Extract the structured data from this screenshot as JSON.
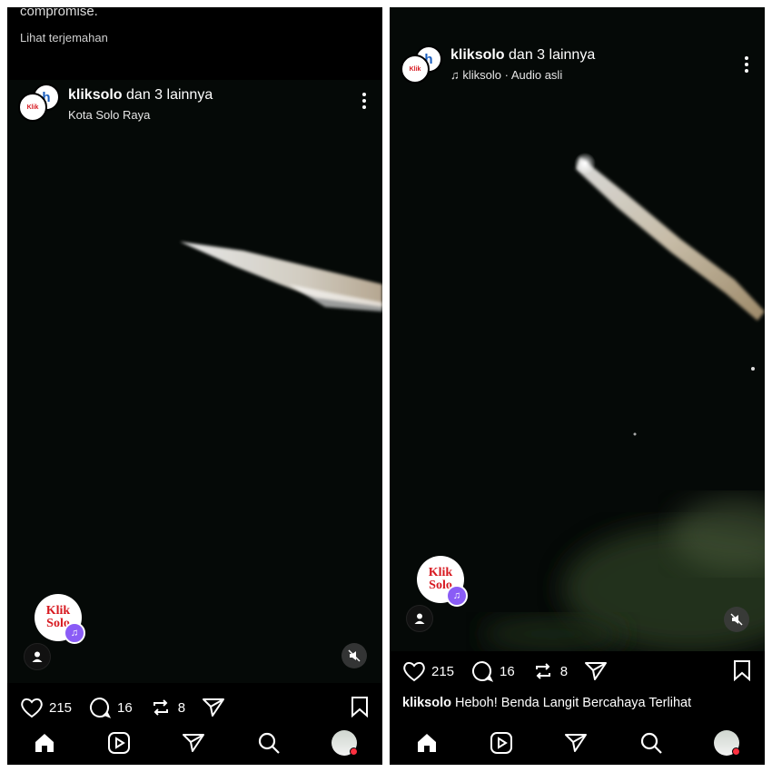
{
  "left": {
    "caption_top_line": "compromise.",
    "translate_link": "Lihat terjemahan",
    "header": {
      "username": "kliksolo",
      "others": "dan 3 lainnya",
      "subtitle": "Kota Solo Raya"
    },
    "logo_text_1": "Klik",
    "logo_text_2": "Solo",
    "stats": {
      "likes": "215",
      "comments": "16",
      "reposts": "8"
    }
  },
  "right": {
    "header": {
      "username": "kliksolo",
      "others": "dan 3 lainnya",
      "subtitle": "kliksolo · Audio asli"
    },
    "logo_text_1": "Klik",
    "logo_text_2": "Solo",
    "stats": {
      "likes": "215",
      "comments": "16",
      "reposts": "8"
    },
    "caption": {
      "username": "kliksolo",
      "text": "Heboh! Benda Langit Bercahaya Terlihat"
    }
  },
  "icons": {
    "like": "heart-icon",
    "comment": "comment-bubble-icon",
    "repost": "repost-icon",
    "share": "send-icon",
    "save": "bookmark-icon",
    "home": "home-icon",
    "reels": "reels-icon",
    "messages": "send-icon",
    "search": "search-icon",
    "profile": "profile-avatar"
  },
  "colors": {
    "background": "#000000",
    "brand_red": "#d71920",
    "badge_purple": "#8a5cf6",
    "notification_red": "#ff3040"
  }
}
